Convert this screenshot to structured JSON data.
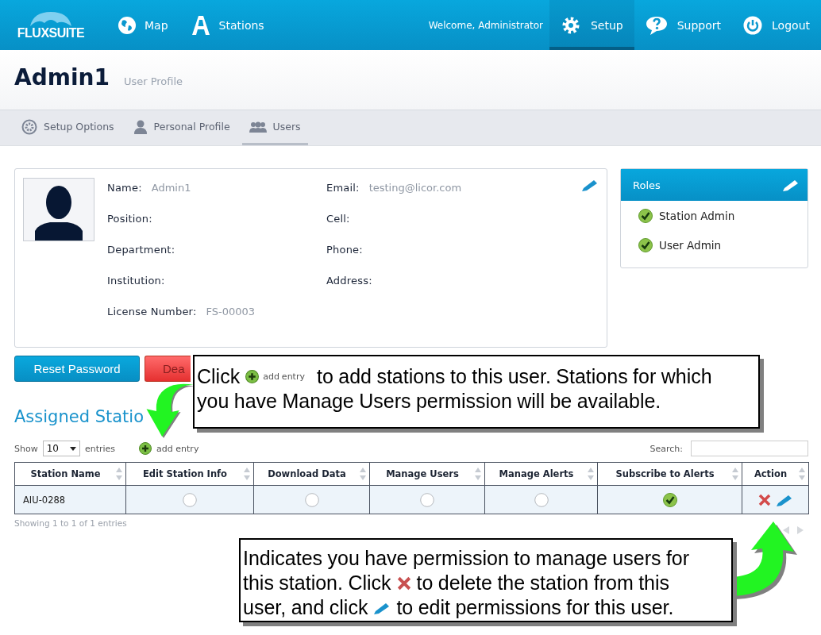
{
  "header": {
    "logo": "FLUXSUITE",
    "nav_left": [
      {
        "label": "Map"
      },
      {
        "label": "Stations"
      }
    ],
    "welcome": "Welcome, Administrator",
    "nav_right": [
      {
        "label": "Setup",
        "selected": true
      },
      {
        "label": "Support",
        "selected": false
      },
      {
        "label": "Logout",
        "selected": false
      }
    ]
  },
  "page": {
    "title": "Admin1",
    "subtitle": "User Profile"
  },
  "tabs": [
    {
      "label": "Setup Options",
      "selected": false
    },
    {
      "label": "Personal Profile",
      "selected": false
    },
    {
      "label": "Users",
      "selected": true
    }
  ],
  "profile": {
    "fields_left": [
      {
        "label": "Name:",
        "value": "Admin1"
      },
      {
        "label": "Position:"
      },
      {
        "label": "Department:"
      },
      {
        "label": "Institution:"
      },
      {
        "label": "License Number:",
        "value": "FS-00003"
      }
    ],
    "fields_right": [
      {
        "label": "Email:",
        "value": "testing@licor.com"
      },
      {
        "label": "Cell:"
      },
      {
        "label": "Phone:"
      },
      {
        "label": "Address:"
      }
    ]
  },
  "roles": {
    "title": "Roles",
    "items": [
      {
        "label": "Station Admin",
        "checked": true
      },
      {
        "label": "User Admin",
        "checked": true
      }
    ]
  },
  "buttons": [
    {
      "label": "Reset Password",
      "kind": "primary"
    },
    {
      "label": "Dea",
      "kind": "danger"
    }
  ],
  "section_title": "Assigned Statio",
  "table_controls": {
    "show": "Show",
    "page_size": "10",
    "entries": "entries",
    "add_entry": "add entry",
    "search_label": "Search:"
  },
  "table": {
    "columns": [
      "Station Name",
      "Edit Station Info",
      "Download Data",
      "Manage Users",
      "Manage Alerts",
      "Subscribe to Alerts",
      "Action"
    ],
    "rows": [
      {
        "station": "AIU-0288",
        "permissions": [
          false,
          false,
          false,
          false,
          true
        ]
      }
    ]
  },
  "footer_info": "Showing 1 to 1 of 1 entries",
  "callouts": [
    {
      "lines": [
        [
          {
            "kind": "text",
            "text": "Click"
          },
          {
            "kind": "add",
            "text": "add entry"
          },
          {
            "kind": "text",
            "text": "to add stations to this user. Stations for which"
          }
        ],
        [
          {
            "kind": "text",
            "text": "you have Manage Users permission will be available."
          }
        ]
      ]
    },
    {
      "lines": [
        [
          {
            "kind": "text",
            "text": "Indicates you have permission to manage users for"
          }
        ],
        [
          {
            "kind": "text",
            "text": "this station. Click"
          },
          {
            "kind": "delete"
          },
          {
            "kind": "text",
            "text": "to delete the station from this"
          }
        ],
        [
          {
            "kind": "text",
            "text": "user, and click"
          },
          {
            "kind": "edit"
          },
          {
            "kind": "text",
            "text": "to edit permissions for this user."
          }
        ]
      ]
    }
  ]
}
